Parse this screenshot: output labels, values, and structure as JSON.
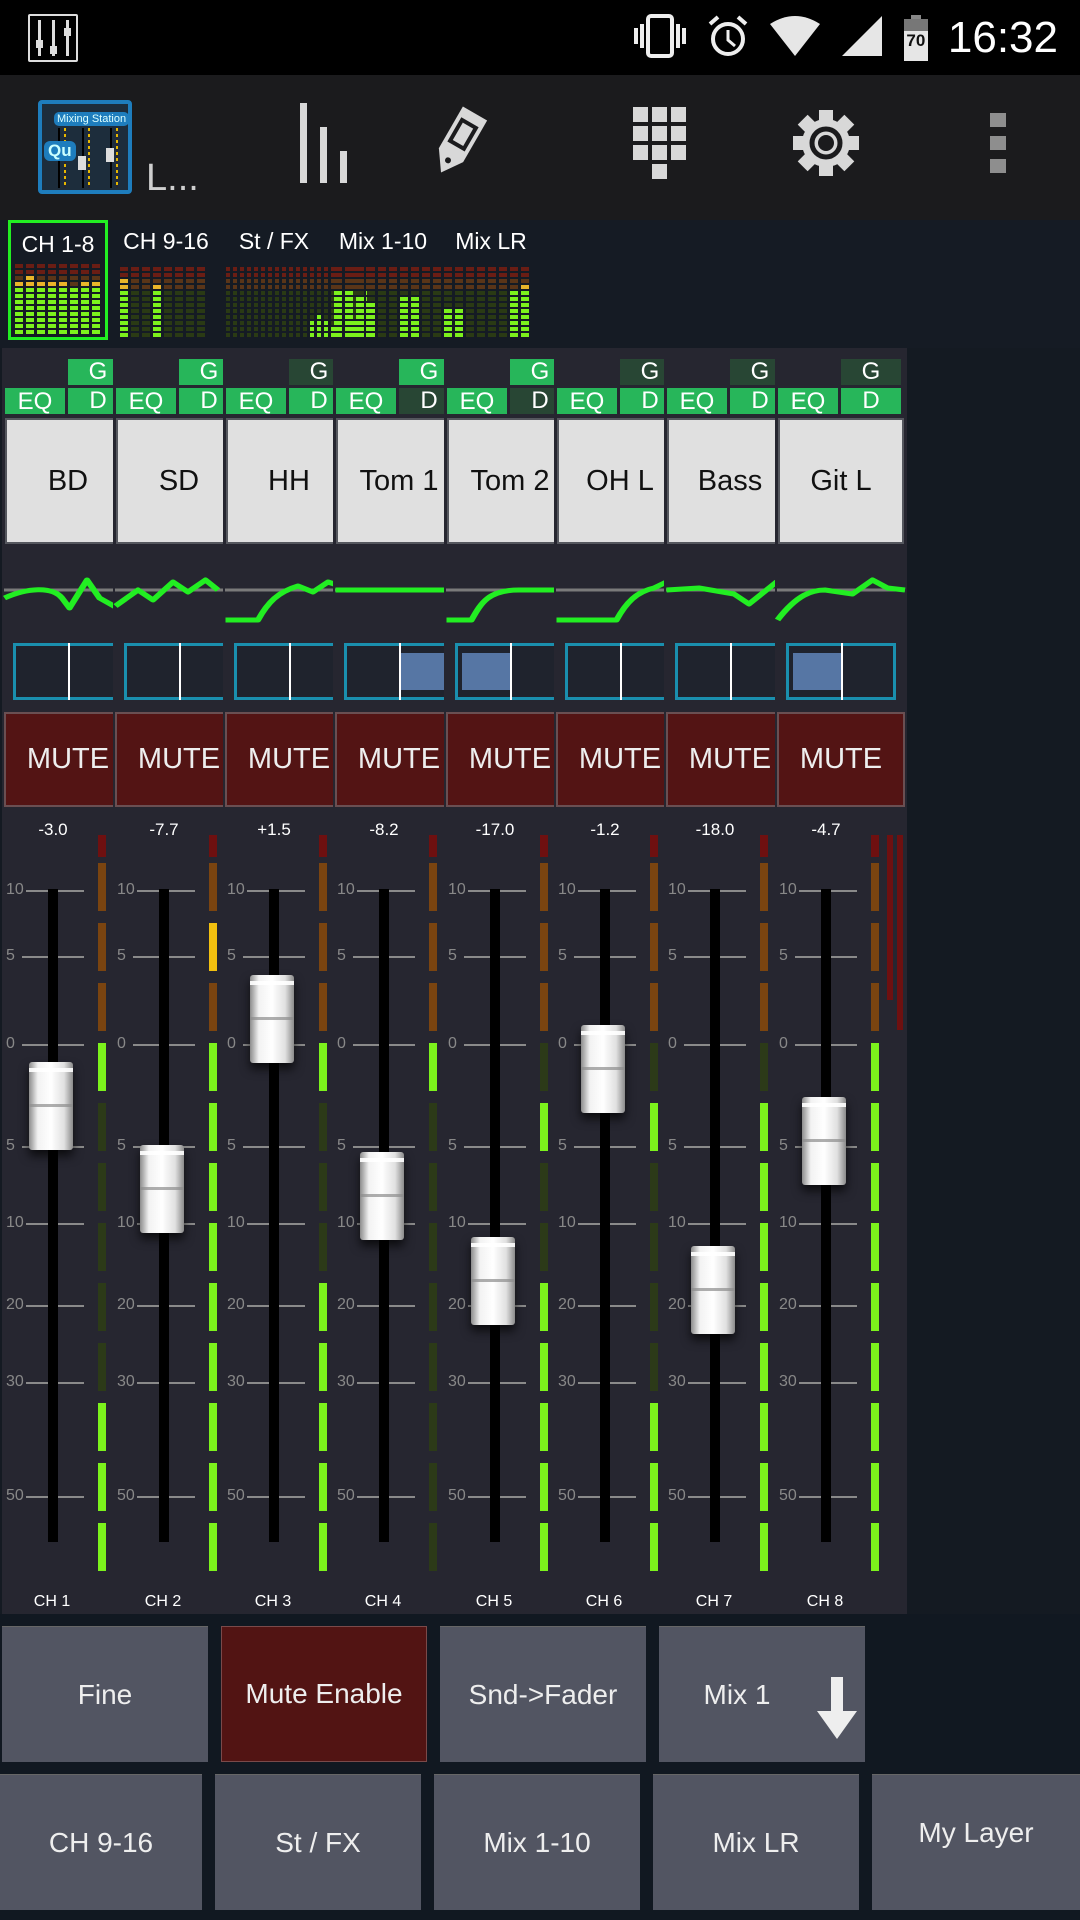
{
  "status_bar": {
    "time": "16:32",
    "battery_percent": "70",
    "icons": [
      "mixer-notification-icon",
      "vibrate-icon",
      "alarm-icon",
      "wifi-icon",
      "cell-signal-icon",
      "battery-icon"
    ]
  },
  "toolbar": {
    "app_logo_label": "Mixing Station",
    "app_logo_badge": "Qu",
    "title": "L...",
    "buttons": [
      {
        "name": "meters-button",
        "icon": "bar-meter-icon"
      },
      {
        "name": "tag-button",
        "icon": "tag-icon"
      },
      {
        "name": "keypad-button",
        "icon": "keypad-icon"
      },
      {
        "name": "settings-button",
        "icon": "gear-icon"
      },
      {
        "name": "overflow-menu-button",
        "icon": "more-vert-icon"
      }
    ]
  },
  "layers": {
    "active": "CH 1-8",
    "tabs": [
      {
        "label": "CH 1-8",
        "active": true,
        "meters": [
          [
            9,
            7
          ],
          [
            10,
            2
          ],
          [
            9,
            3
          ],
          [
            9,
            9
          ],
          [
            9,
            4
          ],
          [
            8,
            4
          ],
          [
            9,
            8
          ],
          [
            9,
            9
          ]
        ]
      },
      {
        "label": "CH 9-16",
        "active": false,
        "meters": [
          [
            10,
            9
          ],
          [
            0,
            0
          ],
          [
            0,
            0
          ],
          [
            9,
            9
          ],
          [
            0,
            0
          ],
          [
            0,
            0
          ],
          [
            0,
            0
          ],
          [
            0,
            0
          ]
        ]
      },
      {
        "label": "St / FX",
        "active": false,
        "meters": [
          [
            0,
            0
          ],
          [
            0,
            0
          ],
          [
            0,
            0
          ],
          [
            0,
            0
          ],
          [
            0,
            0
          ],
          [
            0,
            0
          ],
          [
            0,
            0
          ],
          [
            0,
            0
          ],
          [
            0,
            0
          ],
          [
            0,
            0
          ],
          [
            0,
            0
          ],
          [
            0,
            0
          ],
          [
            3,
            3
          ],
          [
            4,
            4
          ],
          [
            3,
            2
          ],
          [
            2,
            2
          ],
          [
            6,
            6
          ],
          [
            4,
            4
          ],
          [
            3,
            3
          ],
          [
            6,
            6
          ],
          [
            8,
            8
          ]
        ]
      },
      {
        "label": "Mix 1-10",
        "active": false,
        "meters": [
          [
            8,
            0
          ],
          [
            8,
            8
          ],
          [
            7,
            7
          ],
          [
            6,
            6
          ],
          [
            0,
            0
          ],
          [
            0,
            0
          ],
          [
            7,
            7
          ],
          [
            7,
            7
          ],
          [
            0,
            0
          ],
          [
            0,
            0
          ]
        ]
      },
      {
        "label": "Mix LR",
        "active": false,
        "meters": [
          [
            5,
            1
          ],
          [
            5,
            3
          ],
          [
            0,
            0
          ],
          [
            0,
            0
          ],
          [
            0,
            0
          ],
          [
            0,
            0
          ],
          [
            8,
            8
          ],
          [
            9,
            9
          ]
        ]
      }
    ]
  },
  "scale_labels": [
    "10",
    "5",
    "0",
    "5",
    "10",
    "20",
    "30",
    "50"
  ],
  "channels": [
    {
      "id": "CH 1",
      "name": "BD",
      "g_on": true,
      "d_on": true,
      "eq_on": true,
      "pan": 0,
      "gain_db": "-3.0",
      "fader_db": -3.0,
      "eq_curve": "peaky",
      "meter_lit": [
        1,
        0,
        0,
        0,
        0,
        0,
        1,
        1,
        1
      ],
      "peak_amber": -1,
      "gr": [
        0,
        0.06
      ]
    },
    {
      "id": "CH 2",
      "name": "SD",
      "g_on": true,
      "d_on": true,
      "eq_on": true,
      "pan": 0,
      "gain_db": "-7.7",
      "fader_db": -7.7,
      "eq_curve": "bumpy",
      "meter_lit": [
        1,
        1,
        1,
        1,
        1,
        1,
        1,
        1,
        1
      ],
      "peak_amber": 1,
      "gr": [
        0,
        0.5
      ]
    },
    {
      "id": "CH 3",
      "name": "HH",
      "g_on": false,
      "d_on": true,
      "eq_on": true,
      "pan": 0,
      "gain_db": "+1.5",
      "fader_db": 1.5,
      "eq_curve": "hpf-bumps",
      "meter_lit": [
        1,
        0,
        0,
        0,
        1,
        1,
        1,
        1,
        1
      ],
      "peak_amber": -1,
      "gr": [
        0,
        0.03
      ]
    },
    {
      "id": "CH 4",
      "name": "Tom 1",
      "g_on": true,
      "d_on": false,
      "eq_on": true,
      "pan": 1,
      "gain_db": "-8.2",
      "fader_db": -8.2,
      "eq_curve": "flat",
      "meter_lit": [
        1,
        0,
        0,
        0,
        0,
        0,
        0,
        0,
        0
      ],
      "peak_amber": -1,
      "gr": [
        0.25,
        0
      ]
    },
    {
      "id": "CH 5",
      "name": "Tom 2",
      "g_on": true,
      "d_on": false,
      "eq_on": true,
      "pan": -1,
      "gain_db": "-17.0",
      "fader_db": -17.0,
      "eq_curve": "hpf-flat",
      "meter_lit": [
        0,
        1,
        0,
        0,
        1,
        1,
        1,
        1,
        1
      ],
      "peak_amber": -1,
      "gr": [
        0.02,
        0
      ]
    },
    {
      "id": "CH 6",
      "name": "OH L",
      "g_on": false,
      "d_on": true,
      "eq_on": true,
      "pan": 0,
      "gain_db": "-1.2",
      "fader_db": -1.2,
      "eq_curve": "hpf-late",
      "meter_lit": [
        0,
        1,
        0,
        0,
        0,
        0,
        1,
        1,
        1
      ],
      "peak_amber": -1,
      "gr": [
        0.15,
        0
      ]
    },
    {
      "id": "CH 7",
      "name": "Bass",
      "g_on": false,
      "d_on": true,
      "eq_on": true,
      "pan": 0,
      "gain_db": "-18.0",
      "fader_db": -18.0,
      "eq_curve": "dip",
      "meter_lit": [
        0,
        1,
        1,
        1,
        1,
        1,
        1,
        1,
        1
      ],
      "peak_amber": -1,
      "gr": [
        0,
        0.3
      ]
    },
    {
      "id": "CH 8",
      "name": "Git L",
      "g_on": false,
      "d_on": true,
      "eq_on": true,
      "pan": -1,
      "gain_db": "-4.7",
      "fader_db": -4.7,
      "eq_curve": "hpf-bumps2",
      "meter_lit": [
        1,
        1,
        1,
        1,
        1,
        1,
        1,
        1,
        1
      ],
      "peak_amber": -1,
      "gr": [
        0,
        0
      ]
    }
  ],
  "strip_labels": {
    "g": "G",
    "d": "D",
    "eq": "EQ",
    "mute": "MUTE"
  },
  "bottom_row1": [
    {
      "label": "Fine",
      "style": "normal"
    },
    {
      "label": "Mute Enable",
      "style": "active-red"
    },
    {
      "label": "Snd->Fader",
      "style": "normal"
    },
    {
      "label": "Mix 1",
      "style": "normal",
      "icon": "arrow-down-icon"
    }
  ],
  "bottom_row2": [
    {
      "label": "CH 9-16"
    },
    {
      "label": "St / FX"
    },
    {
      "label": "Mix 1-10"
    },
    {
      "label": "Mix LR"
    },
    {
      "label": "My Layer"
    }
  ],
  "colors": {
    "accent_green": "#22ee22",
    "button_on": "#27b65a",
    "button_off": "#284634",
    "mute_red": "#531414",
    "meter_green": "#7cf21c",
    "meter_orange": "#7a4410",
    "meter_red": "#ff2a1a",
    "pan_border": "#1a8fae"
  }
}
